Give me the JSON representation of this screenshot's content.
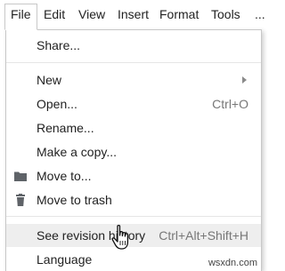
{
  "menubar": {
    "items": [
      "File",
      "Edit",
      "View",
      "Insert",
      "Format",
      "Tools",
      "..."
    ],
    "active": "File"
  },
  "file_menu": {
    "items": [
      {
        "label": "Share...",
        "shortcut": ""
      },
      {
        "label": "New",
        "shortcut": "",
        "submenu": true
      },
      {
        "label": "Open...",
        "shortcut": "Ctrl+O"
      },
      {
        "label": "Rename...",
        "shortcut": ""
      },
      {
        "label": "Make a copy...",
        "shortcut": ""
      },
      {
        "label": "Move to...",
        "shortcut": "",
        "icon": "folder-icon"
      },
      {
        "label": "Move to trash",
        "shortcut": "",
        "icon": "trash-icon"
      },
      {
        "label": "See revision history",
        "shortcut": "Ctrl+Alt+Shift+H",
        "highlighted": true
      },
      {
        "label": "Language",
        "shortcut": ""
      }
    ]
  },
  "watermark": "wsxdn.com",
  "colors": {
    "highlight": "#eeeeee",
    "shortcut_text": "#777777",
    "icon": "#5f6368"
  }
}
